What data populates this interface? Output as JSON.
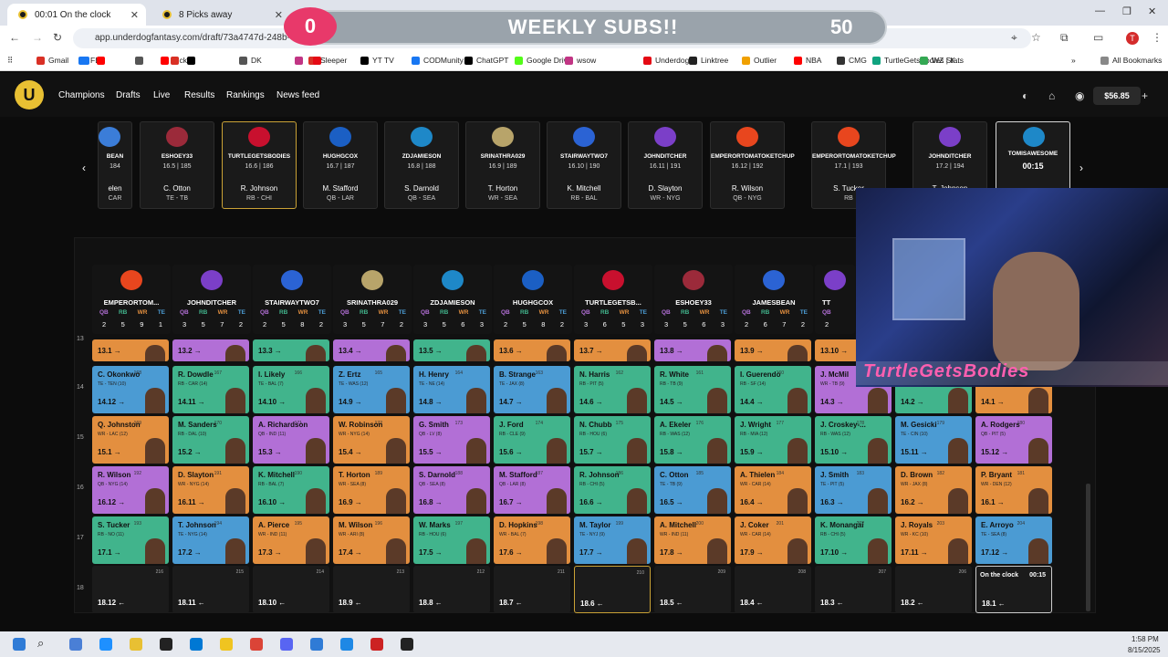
{
  "browser": {
    "tabs": [
      {
        "title": "00:01 On the clock"
      },
      {
        "title": "8 Picks away"
      }
    ],
    "url": "app.underdogfantasy.com/draft/73a4747d-248b-4bf",
    "url_tail": "52162f0df6",
    "bookmarks": [
      "Gmail",
      "FB",
      "Kick",
      "DK",
      "Sleeper",
      "YT TV",
      "CODMunity",
      "ChatGPT",
      "Google Drive",
      "wsow",
      "Underdog",
      "Linktree",
      "Outlier",
      "NBA",
      "CMG",
      "TurtleGetsBodies | K...",
      "WZ Stats",
      "All Bookmarks"
    ],
    "bookmark_colors": [
      "#d93025",
      "#1877f2",
      "#ff0000",
      "#555",
      "#d93025",
      "#000",
      "#1877f2",
      "#000",
      "#53fc18",
      "#c13584",
      "#e50914",
      "#222",
      "#f0a000",
      "#ff0000",
      "#333",
      "#10a37f",
      "#34a853",
      "#888",
      "#e8c033",
      "#27ae60",
      "#888",
      "#1d428a",
      "#111",
      "#27ae60",
      "#c0392b",
      "#888"
    ]
  },
  "overlay": {
    "sub_count": "0",
    "title": "WEEKLY SUBS!!",
    "goal": "50"
  },
  "app": {
    "nav": [
      "Champions",
      "Drafts",
      "Live",
      "Results",
      "Rankings",
      "News feed"
    ],
    "balance": "$56.85"
  },
  "recent_picks": [
    {
      "user": "BEAN",
      "pick": "184",
      "player": "elen",
      "pos": "CAR",
      "color": "#3b7dd8"
    },
    {
      "user": "ESHOEY33",
      "pick": "16.5 | 185",
      "player": "C. Otton",
      "pos": "TE - TB",
      "color": "#9b2a3a"
    },
    {
      "user": "TURTLEGETSBODIES",
      "pick": "16.6 | 186",
      "player": "R. Johnson",
      "pos": "RB - CHI",
      "color": "#c8102e"
    },
    {
      "user": "HUGHGCOX",
      "pick": "16.7 | 187",
      "player": "M. Stafford",
      "pos": "QB - LAR",
      "color": "#1b5fc4"
    },
    {
      "user": "ZDJAMIESON",
      "pick": "16.8 | 188",
      "player": "S. Darnold",
      "pos": "QB - SEA",
      "color": "#1e88c8"
    },
    {
      "user": "SRINATHRA029",
      "pick": "16.9 | 189",
      "player": "T. Horton",
      "pos": "WR - SEA",
      "color": "#b8a46a"
    },
    {
      "user": "STAIRWAYTWO7",
      "pick": "16.10 | 190",
      "player": "K. Mitchell",
      "pos": "RB - BAL",
      "color": "#2b63d4"
    },
    {
      "user": "JOHNDITCHER",
      "pick": "16.11 | 191",
      "player": "D. Slayton",
      "pos": "WR - NYG",
      "color": "#7b3fc8"
    },
    {
      "user": "EMPERORTOMATOKETCHUP",
      "pick": "16.12 | 192",
      "player": "R. Wilson",
      "pos": "QB - NYG",
      "color": "#e8461e"
    },
    {
      "user": "EMPERORTOMATOKETCHUP",
      "pick": "17.1 | 193",
      "player": "S. Tucker",
      "pos": "RB",
      "color": "#e8461e"
    },
    {
      "user": "JOHNDITCHER",
      "pick": "17.2 | 194",
      "player": "T. Johnson",
      "pos": "",
      "color": "#7b3fc8"
    }
  ],
  "on_clock_card": {
    "user": "TOMISAWESOME",
    "time": "00:15"
  },
  "columns": [
    {
      "name": "EMPERORTOM...",
      "counts": [
        "2",
        "5",
        "9",
        "1"
      ],
      "color": "#e8461e"
    },
    {
      "name": "JOHNDITCHER",
      "counts": [
        "3",
        "5",
        "7",
        "2"
      ],
      "color": "#7b3fc8"
    },
    {
      "name": "STAIRWAYTWO7",
      "counts": [
        "2",
        "5",
        "8",
        "2"
      ],
      "color": "#2b63d4"
    },
    {
      "name": "SRINATHRA029",
      "counts": [
        "3",
        "5",
        "7",
        "2"
      ],
      "color": "#b8a46a"
    },
    {
      "name": "ZDJAMIESON",
      "counts": [
        "3",
        "5",
        "6",
        "3"
      ],
      "color": "#1e88c8"
    },
    {
      "name": "HUGHGCOX",
      "counts": [
        "2",
        "5",
        "8",
        "2"
      ],
      "color": "#1b5fc4"
    },
    {
      "name": "TURTLEGETSB...",
      "counts": [
        "3",
        "6",
        "5",
        "3"
      ],
      "color": "#c8102e"
    },
    {
      "name": "ESHOEY33",
      "counts": [
        "3",
        "5",
        "6",
        "3"
      ],
      "color": "#9b2a3a"
    },
    {
      "name": "JAMESBEAN",
      "counts": [
        "2",
        "6",
        "7",
        "2"
      ],
      "color": "#2b63d4"
    },
    {
      "name": "TT",
      "counts": [
        "2",
        "6",
        "",
        ""
      ],
      "color": "#7b3fc8"
    }
  ],
  "position_labels": [
    "QB",
    "RB",
    "WR",
    "TE"
  ],
  "position_colors": {
    "QB": "#b26fd6",
    "RB": "#41b48c",
    "WR": "#e38f3f",
    "TE": "#4b9bd3"
  },
  "row13": [
    {
      "pos": "WR",
      "rk": "13.1"
    },
    {
      "pos": "QB",
      "rk": "13.2"
    },
    {
      "pos": "RB",
      "rk": "13.3"
    },
    {
      "pos": "QB",
      "rk": "13.4"
    },
    {
      "pos": "RB",
      "rk": "13.5"
    },
    {
      "pos": "WR",
      "rk": "13.6"
    },
    {
      "pos": "WR",
      "rk": "13.7"
    },
    {
      "pos": "QB",
      "rk": "13.8"
    },
    {
      "pos": "WR",
      "rk": "13.9"
    },
    {
      "pos": "WR",
      "rk": "13.10"
    }
  ],
  "rows": [
    {
      "label": "14",
      "cells": [
        {
          "pos": "TE",
          "name": "C. Okonkwo",
          "sub": "TE - TEN (10)",
          "num": "168",
          "rk": "14.12"
        },
        {
          "pos": "RB",
          "name": "R. Dowdle",
          "sub": "RB - CAR (14)",
          "num": "167",
          "rk": "14.11"
        },
        {
          "pos": "RB",
          "name": "I. Likely",
          "sub": "TE - BAL (7)",
          "num": "166",
          "rk": "14.10"
        },
        {
          "pos": "TE",
          "name": "Z. Ertz",
          "sub": "TE - WAS (12)",
          "num": "165",
          "rk": "14.9"
        },
        {
          "pos": "TE",
          "name": "H. Henry",
          "sub": "TE - NE (14)",
          "num": "164",
          "rk": "14.8"
        },
        {
          "pos": "TE",
          "name": "B. Strange",
          "sub": "TE - JAX (8)",
          "num": "163",
          "rk": "14.7"
        },
        {
          "pos": "RB",
          "name": "N. Harris",
          "sub": "RB - PIT (5)",
          "num": "162",
          "rk": "14.6"
        },
        {
          "pos": "RB",
          "name": "R. White",
          "sub": "RB - TB (9)",
          "num": "161",
          "rk": "14.5"
        },
        {
          "pos": "RB",
          "name": "I. Guerendo",
          "sub": "RB - SF (14)",
          "num": "160",
          "rk": "14.4"
        },
        {
          "pos": "QB",
          "name": "J. McMil",
          "sub": "WR - TB (9)",
          "num": "",
          "rk": "14.3"
        },
        {
          "pos": "RB",
          "name": "",
          "sub": "",
          "num": "",
          "rk": "14.2"
        },
        {
          "pos": "WR",
          "name": "",
          "sub": "",
          "num": "",
          "rk": "14.1"
        }
      ]
    },
    {
      "label": "15",
      "cells": [
        {
          "pos": "WR",
          "name": "Q. Johnston",
          "sub": "WR - LAC (12)",
          "num": "169",
          "rk": "15.1"
        },
        {
          "pos": "RB",
          "name": "M. Sanders",
          "sub": "RB - DAL (10)",
          "num": "170",
          "rk": "15.2"
        },
        {
          "pos": "QB",
          "name": "A. Richardson",
          "sub": "QB - IND (11)",
          "num": "171",
          "rk": "15.3"
        },
        {
          "pos": "WR",
          "name": "W. Robinson",
          "sub": "WR - NYG (14)",
          "num": "172",
          "rk": "15.4"
        },
        {
          "pos": "QB",
          "name": "G. Smith",
          "sub": "QB - LV (8)",
          "num": "173",
          "rk": "15.5"
        },
        {
          "pos": "RB",
          "name": "J. Ford",
          "sub": "RB - CLE (9)",
          "num": "174",
          "rk": "15.6"
        },
        {
          "pos": "RB",
          "name": "N. Chubb",
          "sub": "RB - HOU (6)",
          "num": "175",
          "rk": "15.7"
        },
        {
          "pos": "RB",
          "name": "A. Ekeler",
          "sub": "RB - WAS (12)",
          "num": "176",
          "rk": "15.8"
        },
        {
          "pos": "RB",
          "name": "J. Wright",
          "sub": "RB - MIA (12)",
          "num": "177",
          "rk": "15.9"
        },
        {
          "pos": "RB",
          "name": "J. Croskey-...",
          "sub": "RB - WAS (12)",
          "num": "178",
          "rk": "15.10"
        },
        {
          "pos": "TE",
          "name": "M. Gesicki",
          "sub": "TE - CIN (10)",
          "num": "179",
          "rk": "15.11"
        },
        {
          "pos": "QB",
          "name": "A. Rodgers",
          "sub": "QB - PIT (5)",
          "num": "180",
          "rk": "15.12"
        }
      ]
    },
    {
      "label": "16",
      "cells": [
        {
          "pos": "QB",
          "name": "R. Wilson",
          "sub": "QB - NYG (14)",
          "num": "192",
          "rk": "16.12"
        },
        {
          "pos": "WR",
          "name": "D. Slayton",
          "sub": "WR - NYG (14)",
          "num": "191",
          "rk": "16.11"
        },
        {
          "pos": "RB",
          "name": "K. Mitchell",
          "sub": "RB - BAL (7)",
          "num": "190",
          "rk": "16.10"
        },
        {
          "pos": "WR",
          "name": "T. Horton",
          "sub": "WR - SEA (8)",
          "num": "189",
          "rk": "16.9"
        },
        {
          "pos": "QB",
          "name": "S. Darnold",
          "sub": "QB - SEA (8)",
          "num": "188",
          "rk": "16.8"
        },
        {
          "pos": "QB",
          "name": "M. Stafford",
          "sub": "QB - LAR (8)",
          "num": "187",
          "rk": "16.7"
        },
        {
          "pos": "RB",
          "name": "R. Johnson",
          "sub": "RB - CHI (5)",
          "num": "186",
          "rk": "16.6"
        },
        {
          "pos": "TE",
          "name": "C. Otton",
          "sub": "TE - TB (9)",
          "num": "185",
          "rk": "16.5"
        },
        {
          "pos": "WR",
          "name": "A. Thielen",
          "sub": "WR - CAR (14)",
          "num": "184",
          "rk": "16.4"
        },
        {
          "pos": "TE",
          "name": "J. Smith",
          "sub": "TE - PIT (5)",
          "num": "183",
          "rk": "16.3"
        },
        {
          "pos": "WR",
          "name": "D. Brown",
          "sub": "WR - JAX (8)",
          "num": "182",
          "rk": "16.2"
        },
        {
          "pos": "WR",
          "name": "P. Bryant",
          "sub": "WR - DEN (12)",
          "num": "181",
          "rk": "16.1"
        }
      ]
    },
    {
      "label": "17",
      "cells": [
        {
          "pos": "RB",
          "name": "S. Tucker",
          "sub": "RB - NO (11)",
          "num": "193",
          "rk": "17.1"
        },
        {
          "pos": "TE",
          "name": "T. Johnson",
          "sub": "TE - NYG (14)",
          "num": "194",
          "rk": "17.2"
        },
        {
          "pos": "WR",
          "name": "A. Pierce",
          "sub": "WR - IND (11)",
          "num": "195",
          "rk": "17.3"
        },
        {
          "pos": "WR",
          "name": "M. Wilson",
          "sub": "WR - ARI (8)",
          "num": "196",
          "rk": "17.4"
        },
        {
          "pos": "RB",
          "name": "W. Marks",
          "sub": "RB - HOU (6)",
          "num": "197",
          "rk": "17.5"
        },
        {
          "pos": "WR",
          "name": "D. Hopkins",
          "sub": "WR - BAL (7)",
          "num": "198",
          "rk": "17.6"
        },
        {
          "pos": "TE",
          "name": "M. Taylor",
          "sub": "TE - NYJ (9)",
          "num": "199",
          "rk": "17.7"
        },
        {
          "pos": "WR",
          "name": "A. Mitchell",
          "sub": "WR - IND (11)",
          "num": "200",
          "rk": "17.8"
        },
        {
          "pos": "WR",
          "name": "J. Coker",
          "sub": "WR - CAR (14)",
          "num": "201",
          "rk": "17.9"
        },
        {
          "pos": "RB",
          "name": "K. Monangai",
          "sub": "RB - CHI (5)",
          "num": "202",
          "rk": "17.10"
        },
        {
          "pos": "WR",
          "name": "J. Royals",
          "sub": "WR - KC (10)",
          "num": "203",
          "rk": "17.11"
        },
        {
          "pos": "TE",
          "name": "E. Arroyo",
          "sub": "TE - SEA (8)",
          "num": "204",
          "rk": "17.12"
        }
      ]
    }
  ],
  "row18": {
    "label": "18",
    "cells": [
      {
        "rk": "18.12",
        "num": "216"
      },
      {
        "rk": "18.11",
        "num": "215"
      },
      {
        "rk": "18.10",
        "num": "214"
      },
      {
        "rk": "18.9",
        "num": "213"
      },
      {
        "rk": "18.8",
        "num": "212"
      },
      {
        "rk": "18.7",
        "num": "211"
      },
      {
        "rk": "18.6",
        "num": "210"
      },
      {
        "rk": "18.5",
        "num": "209"
      },
      {
        "rk": "18.4",
        "num": "208"
      },
      {
        "rk": "18.3",
        "num": "207"
      },
      {
        "rk": "18.2",
        "num": "206"
      },
      {
        "rk": "18.1",
        "num": "",
        "clock": "On the clock",
        "time": "00:15"
      }
    ]
  },
  "row13_label": "13",
  "webcam_text": "TurtleGetsBodies",
  "taskbar": {
    "time": "1:58 PM",
    "date": "8/15/2025",
    "icon_colors": [
      "#2f7bd6",
      "#3b7dd8",
      "#4a7fd6",
      "#1e90ff",
      "#e8c033",
      "#222",
      "#0078d4",
      "#f0c420",
      "#db4437",
      "#5865f2",
      "#2f7bd6",
      "#1e88e5",
      "#cc2222",
      "#222"
    ]
  }
}
